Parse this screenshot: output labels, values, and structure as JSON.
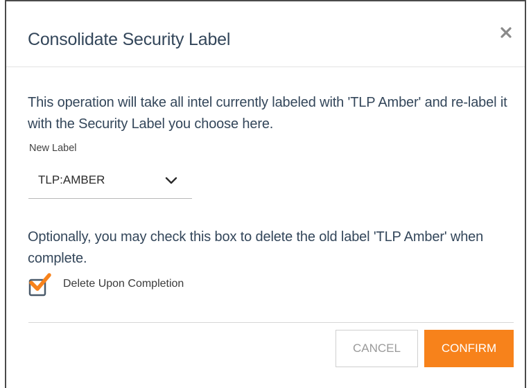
{
  "dialog": {
    "title": "Consolidate Security Label",
    "close_icon": "close-icon",
    "description": "This operation will take all intel currently labeled with 'TLP Amber' and re-label it with the Security Label you choose here.",
    "new_label": {
      "label": "New Label",
      "selected_value": "TLP:AMBER",
      "icon": "chevron-down-icon"
    },
    "optional_text": "Optionally, you may check this box to delete the old label 'TLP Amber' when complete.",
    "delete_checkbox": {
      "label": "Delete Upon Completion",
      "checked": true
    },
    "buttons": {
      "cancel": "CANCEL",
      "confirm": "CONFIRM"
    }
  },
  "colors": {
    "accent": "#f7821b",
    "title_text": "#33465a"
  }
}
